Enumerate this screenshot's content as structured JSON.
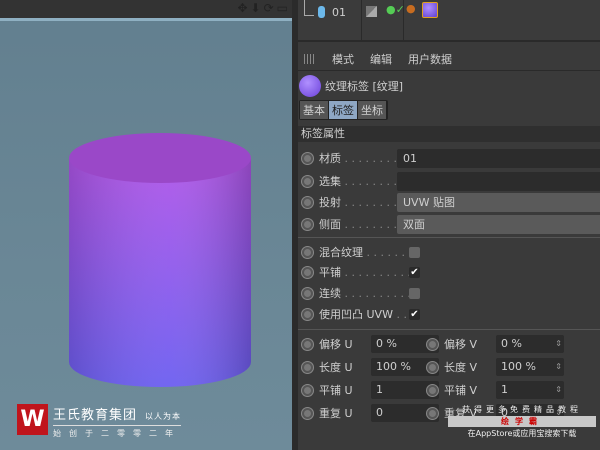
{
  "viewport": {
    "icons": [
      "move-icon",
      "arrow-down-icon",
      "rotate-icon",
      "window-icon"
    ]
  },
  "logo": {
    "mark": "W",
    "name": "王氏教育集团",
    "slogan": "以人为本",
    "founded": "始创于二零零二年"
  },
  "object_manager": {
    "object_name": "01"
  },
  "menu": {
    "items": [
      "模式",
      "编辑",
      "用户数据"
    ]
  },
  "tag": {
    "title": "纹理标签 [纹理]",
    "tabs": [
      {
        "label": "基本",
        "active": false
      },
      {
        "label": "标签",
        "active": true
      },
      {
        "label": "坐标",
        "active": false
      }
    ]
  },
  "section": "标签属性",
  "fields": {
    "material": {
      "label": "材质",
      "value": "01"
    },
    "selection": {
      "label": "选集",
      "value": ""
    },
    "projection": {
      "label": "投射",
      "value": "UVW 贴图"
    },
    "side": {
      "label": "侧面",
      "value": "双面"
    }
  },
  "checks": [
    {
      "label": "混合纹理",
      "checked": false
    },
    {
      "label": "平铺",
      "checked": true
    },
    {
      "label": "连续",
      "checked": false
    },
    {
      "label": "使用凹凸 UVW",
      "checked": true
    }
  ],
  "nums": {
    "offset_u": {
      "label": "偏移 U",
      "value": "0 %"
    },
    "offset_v": {
      "label": "偏移 V",
      "value": "0 %"
    },
    "length_u": {
      "label": "长度 U",
      "value": "100 %"
    },
    "length_v": {
      "label": "长度 V",
      "value": "100 %"
    },
    "tile_u": {
      "label": "平铺 U",
      "value": "1"
    },
    "tile_v": {
      "label": "平铺 V",
      "value": "1"
    },
    "repeat_u": {
      "label": "重复 U",
      "value": "0"
    },
    "repeat_v": {
      "label": "重复 V",
      "value": "0"
    }
  },
  "watermark": {
    "line1": "获得更多免费精品教程",
    "line2": "绘学霸",
    "line3": "在AppStore或应用宝搜索下载"
  }
}
